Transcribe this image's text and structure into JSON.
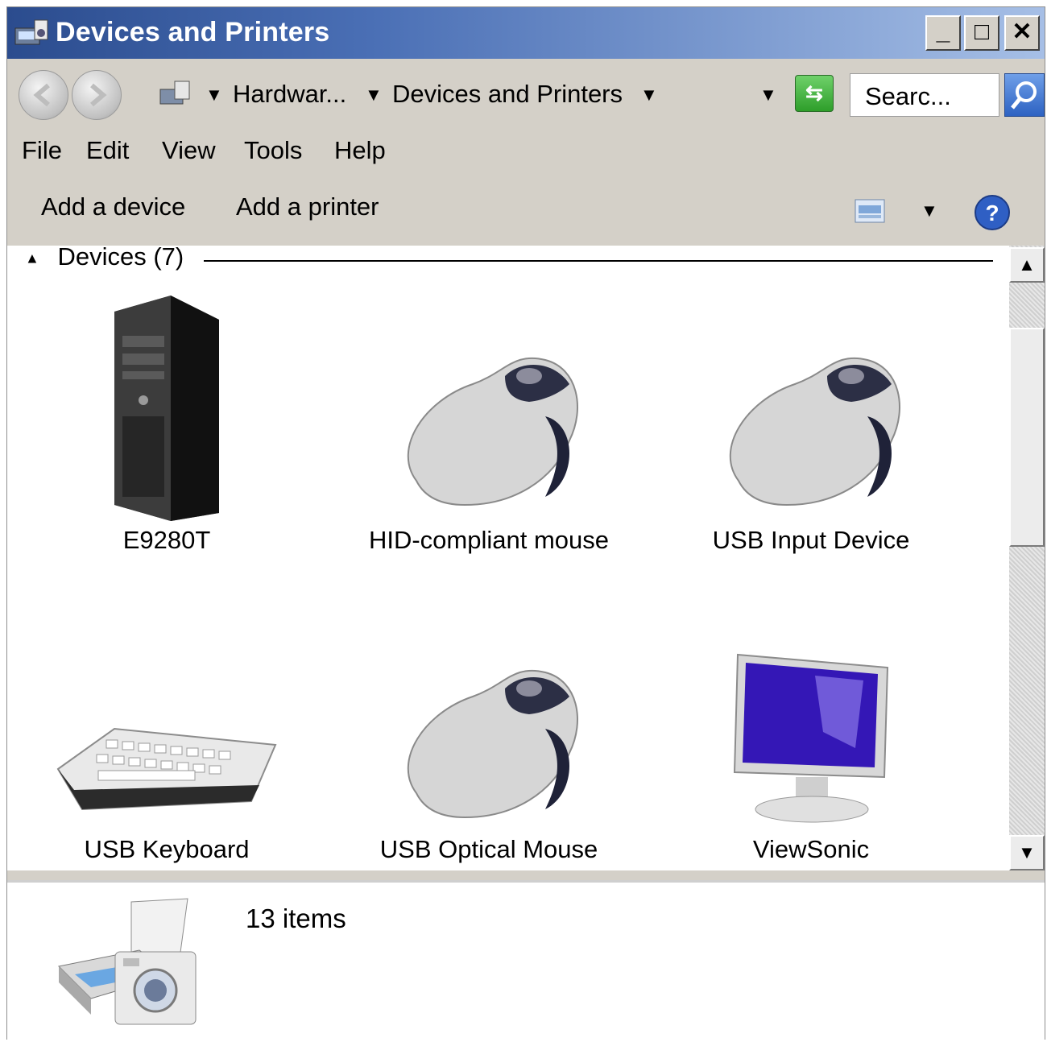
{
  "window": {
    "title": "Devices and Printers",
    "controls": {
      "minimize": "_",
      "maximize": "□",
      "close": "✕"
    }
  },
  "nav": {
    "back_label": "Back",
    "forward_label": "Forward",
    "breadcrumb": [
      "Hardwar...",
      "Devices and Printers"
    ],
    "search_placeholder": "Searc..."
  },
  "menu": [
    "File",
    "Edit",
    "View",
    "Tools",
    "Help"
  ],
  "commands": {
    "add_device": "Add a device",
    "add_printer": "Add a printer"
  },
  "group": {
    "title": "Devices (7)"
  },
  "devices": [
    {
      "label": "E9280T",
      "icon": "desktop-tower-icon"
    },
    {
      "label": "HID-compliant mouse",
      "icon": "mouse-icon"
    },
    {
      "label": "USB Input Device",
      "icon": "mouse-icon"
    },
    {
      "label": "USB Keyboard",
      "icon": "keyboard-icon"
    },
    {
      "label": "USB Optical Mouse",
      "icon": "mouse-icon"
    },
    {
      "label": "ViewSonic",
      "icon": "monitor-icon"
    }
  ],
  "details": {
    "count": "13 items",
    "icon": "printer-camera-icon"
  }
}
